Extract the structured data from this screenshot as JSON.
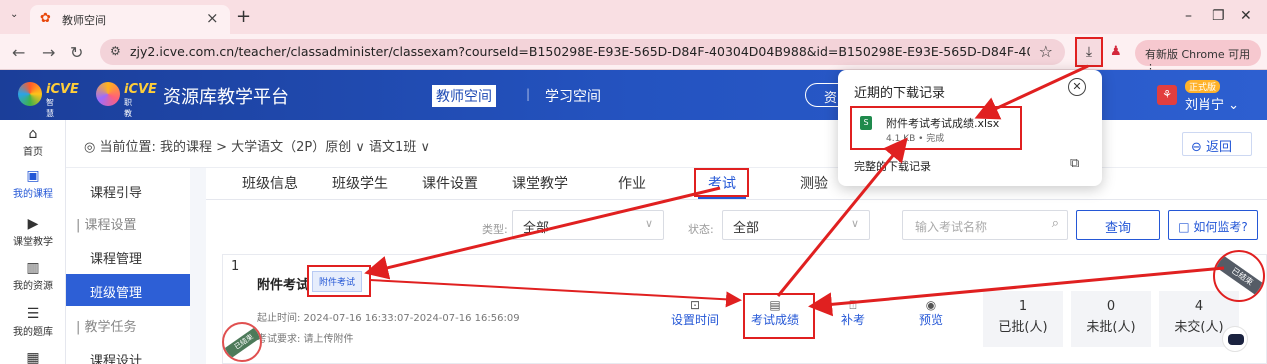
{
  "browser": {
    "tab_title": "教师空间",
    "tab_favicon": "✿",
    "url": "zjy2.icve.com.cn/teacher/classadminister/classexam?courseId=B150298E-E93E-565D-D84F-40304D04B988&id=B150298E-E93E-565D-D84F-40304D892D89&clas...",
    "update_button": "有新版 Chrome 可用 ⋮"
  },
  "header": {
    "logo1_text": "iCVE",
    "logo1_sub": "智慧职教",
    "logo2_text": "iCVE",
    "logo2_sub": "职教云",
    "platform_name": "资源库教学平台",
    "nav_teacher": "教师空间",
    "nav_separator": "|",
    "nav_study": "学习空间",
    "pill_text": "资",
    "user_badge": "正式版",
    "user_name": "刘肖宁 ⌄"
  },
  "rail": [
    {
      "label": "首页",
      "icon": "home-icon",
      "glyph": "⌂"
    },
    {
      "label": "我的课程",
      "icon": "book-icon",
      "glyph": "▣"
    },
    {
      "label": "课堂教学",
      "icon": "play-icon",
      "glyph": "▶"
    },
    {
      "label": "我的资源",
      "icon": "library-icon",
      "glyph": "▥"
    },
    {
      "label": "我的题库",
      "icon": "question-bank-icon",
      "glyph": "☰"
    }
  ],
  "breadcrumb": {
    "text": "当前位置: 我的课程 > 大学语文（2P）原创 ∨ 语文1班 ∨",
    "back": "⊖ 返回"
  },
  "subside": [
    {
      "label": "课程引导"
    },
    {
      "label": "| 课程设置"
    },
    {
      "label": "课程管理"
    },
    {
      "label": "班级管理"
    },
    {
      "label": "| 教学任务"
    },
    {
      "label": "课程设计"
    }
  ],
  "tabs": [
    "班级信息",
    "班级学生",
    "课件设置",
    "课堂教学",
    "作业",
    "考试",
    "测验"
  ],
  "filters": {
    "type_label": "类型:",
    "type_value": "全部",
    "status_label": "状态:",
    "status_value": "全部",
    "search_placeholder": "输入考试名称",
    "query_button": "查询",
    "monitor_button": "□ 如何监考?"
  },
  "exam": {
    "index": "1",
    "name": "附件考试",
    "tag": "附件考试",
    "time": "起止时间: 2024-07-16 16:33:07-2024-07-16 16:56:09",
    "requirement": "考试要求: 请上传附件",
    "actions": [
      {
        "label": "设置时间",
        "glyph": "⊡"
      },
      {
        "label": "考试成绩",
        "glyph": "▤"
      },
      {
        "label": "补考",
        "glyph": "⍐"
      },
      {
        "label": "预览",
        "glyph": "◉"
      }
    ],
    "stats": [
      {
        "num": "1",
        "label": "已批(人)"
      },
      {
        "num": "0",
        "label": "未批(人)"
      },
      {
        "num": "4",
        "label": "未交(人)"
      }
    ],
    "ended_ribbon": "已结束",
    "corner_ribbon": "已结束"
  },
  "download_popup": {
    "title": "近期的下载记录",
    "file_name": "附件考试考试成绩.xlsx",
    "file_meta": "4.1 KB • 完成",
    "view_all": "完整的下载记录",
    "file_icon_text": "S"
  },
  "colors": {
    "accent": "#2457d6",
    "highlight": "#e02020",
    "header": "#1f4bb5"
  }
}
